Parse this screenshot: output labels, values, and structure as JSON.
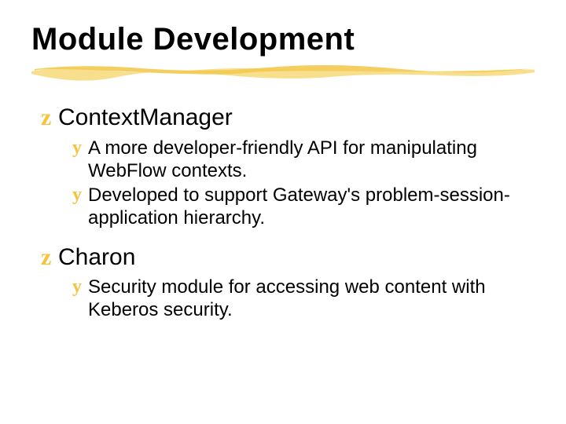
{
  "title": "Module Development",
  "sections": [
    {
      "heading": "ContextManager",
      "items": [
        "A more developer-friendly API for manipulating WebFlow contexts.",
        "Developed to support Gateway's problem-session-application hierarchy."
      ]
    },
    {
      "heading": "Charon",
      "items": [
        "Security module for accessing web content with Keberos security."
      ]
    }
  ],
  "bullets": {
    "level1": "z",
    "level2": "y"
  }
}
